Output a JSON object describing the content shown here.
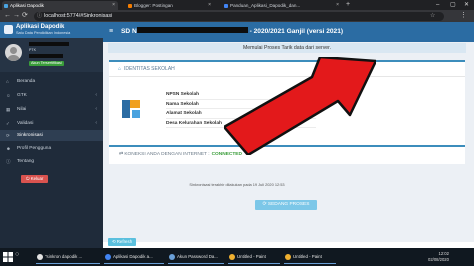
{
  "browser": {
    "tabs": [
      {
        "label": "Aplikasi Dapodik",
        "active": true
      },
      {
        "label": "Blogger: Postingan",
        "active": false
      },
      {
        "label": "Panduan_Aplikasi_Dapodik_dan...",
        "active": false
      }
    ],
    "url": "localhost:5774/#Sinkronisasi"
  },
  "sidebar": {
    "app_title": "Aplikasi Dapodik",
    "app_subtitle": "Satu Data Pendidikan Indonesia",
    "user_role": "PTK",
    "user_status": "Akun Tersertifikasi",
    "menu": [
      {
        "label": "Beranda",
        "icon": "home-icon",
        "glyph": "⌂",
        "has_submenu": false,
        "active": false
      },
      {
        "label": "GTK",
        "icon": "users-icon",
        "glyph": "☺",
        "has_submenu": true,
        "active": false
      },
      {
        "label": "Nilai",
        "icon": "chart-icon",
        "glyph": "▦",
        "has_submenu": true,
        "active": false
      },
      {
        "label": "Validasi",
        "icon": "check-icon",
        "glyph": "✓",
        "has_submenu": true,
        "active": false
      },
      {
        "label": "Sinkronisasi",
        "icon": "sync-icon",
        "glyph": "⟳",
        "has_submenu": false,
        "active": true
      },
      {
        "label": "Profil Pengguna",
        "icon": "user-icon",
        "glyph": "☻",
        "has_submenu": false,
        "active": false
      },
      {
        "label": "Tentang",
        "icon": "info-icon",
        "glyph": "ⓘ",
        "has_submenu": false,
        "active": false
      }
    ],
    "logout_label": "Keluar"
  },
  "header": {
    "title_prefix": "SD N",
    "title_suffix": " - 2020/2021 Ganjil (versi 2021)"
  },
  "main": {
    "notice": "Memulai Proses Tarik data dari server.",
    "identity_title": "IDENTITAS SEKOLAH",
    "fields": [
      "NPSN Sekolah",
      "Nama Sekolah",
      "Alamat Sekolah",
      "Desa Kelurahan Sekolah"
    ],
    "connection_label": "KONEKSI ANDA DENGAN INTERNET :",
    "connection_status": "CONNECTED",
    "last_sync": "Sinkronisasi terakhir dilakukan pada 19 Juli 2020 12:53",
    "process_button": "SEDANG PROSES",
    "back_button": "Refresh"
  },
  "taskbar": {
    "items": [
      {
        "label": "\"sinkron dapodik ...",
        "color": "#e2e2e2"
      },
      {
        "label": "Aplikasi Dapodik a...",
        "color": "#4285f4"
      },
      {
        "label": "Akun Password Da...",
        "color": "#6aa0d8"
      },
      {
        "label": "Untitled - Paint",
        "color": "#f0b030"
      },
      {
        "label": "Untitled - Paint",
        "color": "#f0b030"
      }
    ],
    "time": "12:02",
    "date": "02/08/2020"
  },
  "colors": {
    "brand_blue": "#2b6ca3",
    "sidebar_bg": "#1f2b3a",
    "connected_green": "#3a9d3a",
    "arrow_red": "#e3191b",
    "logout_red": "#d9534f"
  }
}
